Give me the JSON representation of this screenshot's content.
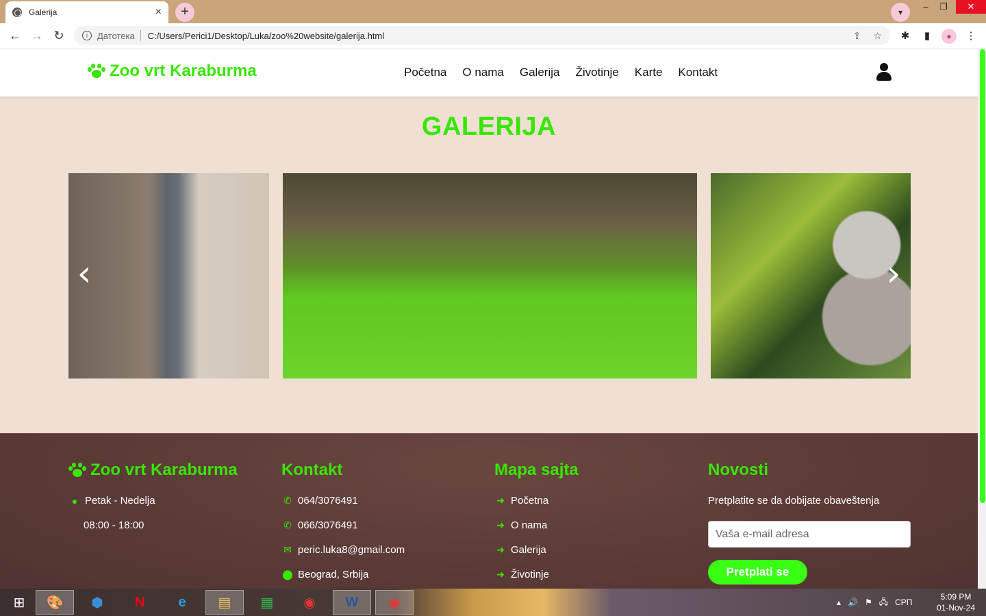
{
  "browser": {
    "tab_title": "Galerija",
    "tab_close": "×",
    "new_tab": "+",
    "scheme_label": "Датотека",
    "url": "C:/Users/Perici1/Desktop/Luka/zoo%20website/galerija.html",
    "win_min": "–",
    "win_max": "❐",
    "win_close": "✕"
  },
  "site": {
    "logo": "Zoo vrt Karaburma",
    "nav": [
      "Početna",
      "O nama",
      "Galerija",
      "Životinje",
      "Karte",
      "Kontakt"
    ]
  },
  "gallery": {
    "title": "GALERIJA",
    "prev": "‹",
    "next": "›"
  },
  "footer": {
    "col1": {
      "title": "Zoo vrt Karaburma",
      "days": "Petak - Nedelja",
      "hours": "08:00 - 18:00"
    },
    "col2": {
      "title": "Kontakt",
      "phone1": "064/3076491",
      "phone2": "066/3076491",
      "email": "peric.luka8@gmail.com",
      "address": "Beograd, Srbija"
    },
    "col3": {
      "title": "Mapa sajta",
      "links": [
        "Početna",
        "O nama",
        "Galerija",
        "Životinje"
      ]
    },
    "col4": {
      "title": "Novosti",
      "text": "Pretplatite se da dobijate obaveštenja",
      "placeholder": "Vaša e-mail adresa",
      "button": "Pretplati se"
    }
  },
  "taskbar": {
    "lang": "СРП",
    "time": "5:09 PM",
    "date": "01-Nov-24"
  },
  "colors": {
    "accent": "#39e600",
    "footer_bg": "#5a3a36",
    "page_bg": "#efe0d3"
  }
}
